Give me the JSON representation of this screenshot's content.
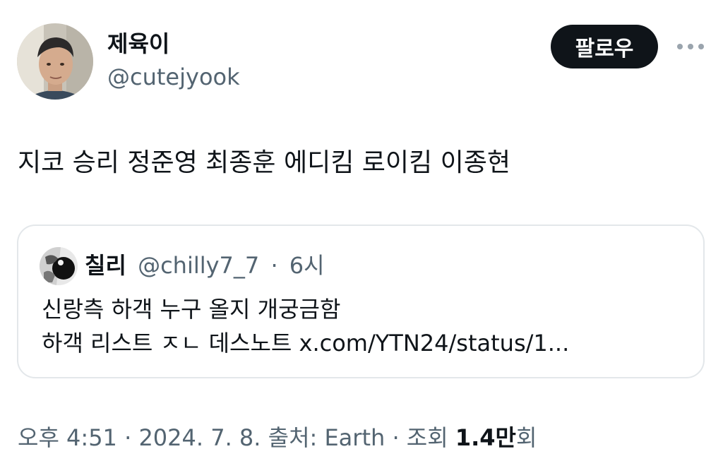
{
  "author": {
    "display_name": "제육이",
    "handle": "@cutejyook"
  },
  "header": {
    "follow_label": "팔로우",
    "more_icon": "more-horizontal-icon"
  },
  "tweet": {
    "text": "지코 승리 정준영 최종훈 에디킴 로이킴 이종현"
  },
  "quote": {
    "name": "칠리",
    "handle": "@chilly7_7",
    "separator": "·",
    "time": "6시",
    "line1": "신랑측 하객 누구 올지 개궁금함",
    "line2": "하객 리스트 ㅈㄴ 데스노트 x.com/YTN24/status/1..."
  },
  "meta": {
    "time": "오후 4:51",
    "separator": " · ",
    "date": "2024. 7. 8.",
    "source": "출처: Earth",
    "views_label": "조회",
    "views_count": "1.4만",
    "views_suffix": "회"
  },
  "colors": {
    "text_primary": "#0f1419",
    "text_secondary": "#536471",
    "follow_bg": "#0f1419",
    "border": "#e3e7ea"
  }
}
